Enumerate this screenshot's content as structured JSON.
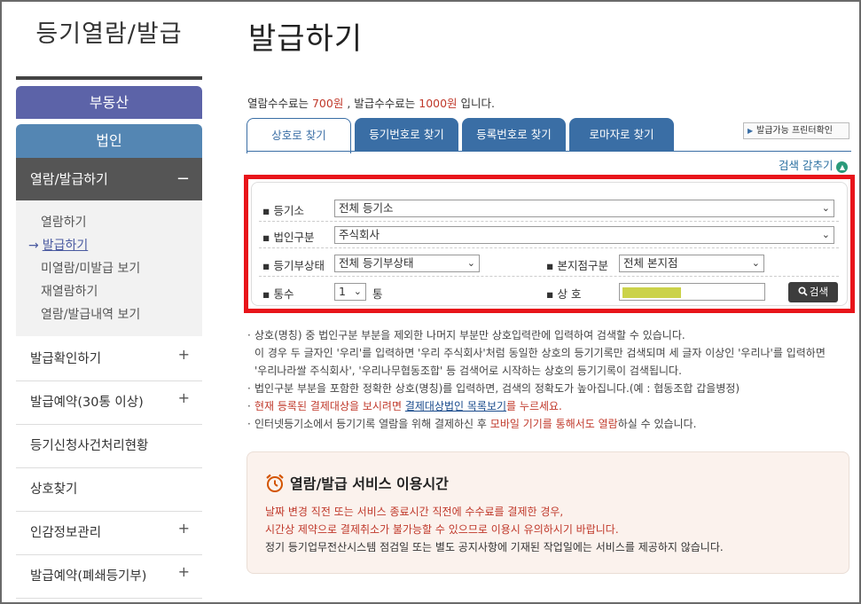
{
  "sidebar": {
    "title": "등기열람/발급",
    "realestate": "부동산",
    "corp": "법인",
    "active_menu": "열람/발급하기",
    "active_sign": "−",
    "submenu": [
      "열람하기",
      "발급하기",
      "미열람/미발급 보기",
      "재열람하기",
      "열람/발급내역 보기"
    ],
    "current_arrow": "→",
    "items": [
      {
        "label": "발급확인하기",
        "sign": "+"
      },
      {
        "label": "발급예약(30통 이상)",
        "sign": "+"
      },
      {
        "label": "등기신청사건처리현황",
        "sign": ""
      },
      {
        "label": "상호찾기",
        "sign": ""
      },
      {
        "label": "인감정보관리",
        "sign": "+"
      },
      {
        "label": "발급예약(폐쇄등기부)",
        "sign": "+"
      }
    ]
  },
  "main": {
    "title": "발급하기",
    "fee": {
      "prefix": "열람수수료는 ",
      "view_fee": "700원",
      "middle": " , 발급수수료는 ",
      "issue_fee": "1000원",
      "suffix": " 입니다."
    },
    "tabs": [
      "상호로 찾기",
      "등기번호로 찾기",
      "등록번호로 찾기",
      "로마자로 찾기"
    ],
    "printer_button": "발급가능 프린터확인",
    "collapse_link": "검색 감추기",
    "form": {
      "registry_office_label": "등기소",
      "registry_office_value": "전체 등기소",
      "corp_type_label": "법인구분",
      "corp_type_value": "주식회사",
      "status_label": "등기부상태",
      "status_value": "전체 등기부상태",
      "branch_label": "본지점구분",
      "branch_value": "전체 본지점",
      "count_label": "통수",
      "count_value": "1",
      "count_unit": "통",
      "name_label": "상 호",
      "search_button": "검색"
    },
    "notes": {
      "n1_line1": "상호(명칭) 중 법인구분 부분을 제외한 나머지 부분만 상호입력란에 입력하여 검색할 수 있습니다.",
      "n1_line2": "이 경우 두 글자인 '우리'를 입력하면 '우리 주식회사'처럼 동일한 상호의 등기기록만 검색되며 세 글자 이상인 '우리나'를 입력하면",
      "n1_line3": "'우리나라쌀 주식회사', '우리나무협동조합' 등 검색어로 시작하는 상호의 등기기록이 검색됩니다.",
      "n2": "법인구분 부분을 포함한 정확한 상호(명칭)를 입력하면, 검색의 정확도가 높아집니다.(예 : 협동조합 갑을병정)",
      "n3_red1": "현재 등록된 결제대상을 보시려면 ",
      "n3_link": "결제대상법인 목록보기",
      "n3_red2": "를 누르세요.",
      "n4_a": "인터넷등기소에서 등기기록 열람을 위해 결제하신 후 ",
      "n4_red": "모바일 기기를 통해서도 열람",
      "n4_b": "하실 수 있습니다."
    },
    "service": {
      "title": "열람/발급 서비스 이용시간",
      "line1": "날짜 변경 직전 또는 서비스 종료시간 직전에 수수료를 결제한 경우,",
      "line2": "시간상 제약으로 결제취소가 불가능할 수 있으므로 이용시 유의하시기 바랍니다.",
      "line3": "정기 등기업무전산시스템 점검일 또는 별도 공지사항에 기재된 작업일에는 서비스를 제공하지 않습니다."
    },
    "icons": {
      "bullet": "▪",
      "note_bullet": "·",
      "printer_tri": "▶",
      "collapse": "▲",
      "chevron": "⌄",
      "search": "search-icon",
      "clock": "alarm-clock-icon"
    },
    "colors": {
      "accent_red": "#c0392b",
      "tab_blue": "#3a6ea5",
      "highlight_frame": "#e8141a",
      "sidebar_purple": "#5c63a8",
      "sidebar_blue": "#5486b3"
    }
  }
}
